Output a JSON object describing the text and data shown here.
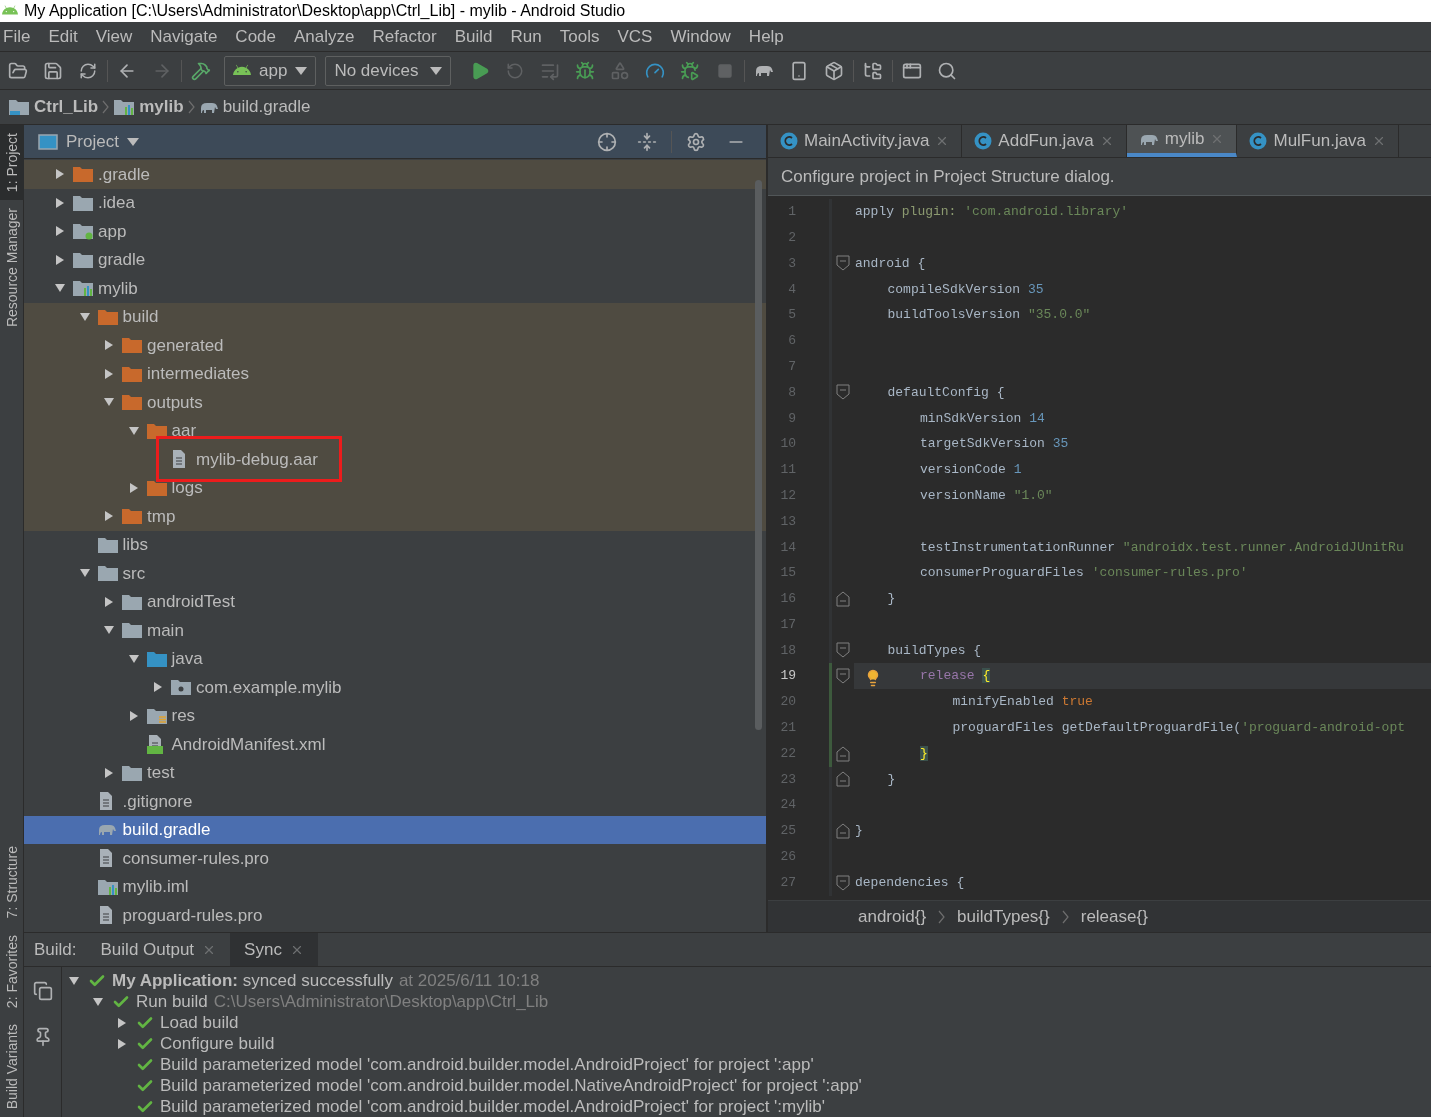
{
  "window": {
    "title": "My Application [C:\\Users\\Administrator\\Desktop\\app\\Ctrl_Lib] - mylib - Android Studio"
  },
  "menu": [
    "File",
    "Edit",
    "View",
    "Navigate",
    "Code",
    "Analyze",
    "Refactor",
    "Build",
    "Run",
    "Tools",
    "VCS",
    "Window",
    "Help"
  ],
  "toolbar": {
    "run_config": "app",
    "device": "No devices"
  },
  "breadcrumb": [
    {
      "label": "Ctrl_Lib",
      "kind": "project"
    },
    {
      "label": "mylib",
      "kind": "module"
    },
    {
      "label": "build.gradle",
      "kind": "gradle"
    }
  ],
  "tool_strip": {
    "top": [
      {
        "label": "1: Project",
        "selected": true
      },
      {
        "label": "Resource Manager",
        "selected": false
      }
    ],
    "bottom": [
      {
        "label": "7: Structure",
        "selected": false
      },
      {
        "label": "2: Favorites",
        "selected": false
      },
      {
        "label": "Build Variants",
        "selected": false
      }
    ]
  },
  "project": {
    "view": "Project",
    "tree": [
      {
        "label": ".gradle",
        "kind": "folder_excluded",
        "excluded": true,
        "selected": false,
        "expanded": false
      },
      {
        "label": ".idea",
        "kind": "folder",
        "excluded": false,
        "selected": false,
        "expanded": false
      },
      {
        "label": "app",
        "kind": "app_module",
        "excluded": false,
        "selected": false,
        "expanded": false
      },
      {
        "label": "gradle",
        "kind": "folder",
        "excluded": false,
        "selected": false,
        "expanded": false
      },
      {
        "label": "mylib",
        "kind": "module",
        "excluded": false,
        "selected": false,
        "expanded": true,
        "children": [
          {
            "label": "build",
            "kind": "folder_excluded",
            "excluded": true,
            "selected": false,
            "expanded": true,
            "children": [
              {
                "label": "generated",
                "kind": "folder_excluded",
                "excluded": true,
                "selected": false,
                "expanded": false
              },
              {
                "label": "intermediates",
                "kind": "folder_excluded",
                "excluded": true,
                "selected": false,
                "expanded": false
              },
              {
                "label": "outputs",
                "kind": "folder_excluded",
                "excluded": true,
                "selected": false,
                "expanded": true,
                "children": [
                  {
                    "label": "aar",
                    "kind": "folder_excluded",
                    "excluded": true,
                    "selected": false,
                    "expanded": true,
                    "children": [
                      {
                        "label": "mylib-debug.aar",
                        "kind": "file",
                        "excluded": true,
                        "selected": false,
                        "annotated": true
                      }
                    ]
                  },
                  {
                    "label": "logs",
                    "kind": "folder_excluded",
                    "excluded": true,
                    "selected": false,
                    "expanded": false
                  }
                ]
              },
              {
                "label": "tmp",
                "kind": "folder_excluded",
                "excluded": true,
                "selected": false,
                "expanded": false
              }
            ]
          },
          {
            "label": "libs",
            "kind": "folder",
            "excluded": false,
            "selected": false
          },
          {
            "label": "src",
            "kind": "folder",
            "excluded": false,
            "selected": false,
            "expanded": true,
            "children": [
              {
                "label": "androidTest",
                "kind": "folder",
                "excluded": false,
                "selected": false,
                "expanded": false
              },
              {
                "label": "main",
                "kind": "folder",
                "excluded": false,
                "selected": false,
                "expanded": true,
                "children": [
                  {
                    "label": "java",
                    "kind": "source_folder",
                    "excluded": false,
                    "selected": false,
                    "expanded": true,
                    "children": [
                      {
                        "label": "com.example.mylib",
                        "kind": "package",
                        "excluded": false,
                        "selected": false,
                        "expanded": false
                      }
                    ]
                  },
                  {
                    "label": "res",
                    "kind": "res_folder",
                    "excluded": false,
                    "selected": false,
                    "expanded": false
                  },
                  {
                    "label": "AndroidManifest.xml",
                    "kind": "manifest",
                    "excluded": false,
                    "selected": false
                  }
                ]
              },
              {
                "label": "test",
                "kind": "folder",
                "excluded": false,
                "selected": false,
                "expanded": false
              }
            ]
          },
          {
            "label": ".gitignore",
            "kind": "file",
            "excluded": false,
            "selected": false
          },
          {
            "label": "build.gradle",
            "kind": "gradle_file",
            "excluded": false,
            "selected": true
          },
          {
            "label": "consumer-rules.pro",
            "kind": "file",
            "excluded": false,
            "selected": false
          },
          {
            "label": "mylib.iml",
            "kind": "module",
            "excluded": false,
            "selected": false
          },
          {
            "label": "proguard-rules.pro",
            "kind": "file",
            "excluded": false,
            "selected": false
          }
        ]
      }
    ]
  },
  "editor": {
    "tabs": [
      {
        "label": "MainActivity.java",
        "kind": "java",
        "selected": false
      },
      {
        "label": "AddFun.java",
        "kind": "java",
        "selected": false
      },
      {
        "label": "mylib",
        "kind": "gradle",
        "selected": true
      },
      {
        "label": "MulFun.java",
        "kind": "java",
        "selected": false
      }
    ],
    "notice": "Configure project in Project Structure dialog.",
    "lines": [
      {
        "number": "1",
        "kind": "plain",
        "current": false,
        "changed": false,
        "tokens": [
          {
            "kind": "plain",
            "text": "apply "
          },
          {
            "kind": "arg",
            "text": "plugin: "
          },
          {
            "kind": "string",
            "text": "'com.android.library'"
          }
        ]
      },
      {
        "number": "2",
        "kind": "plain",
        "current": false,
        "changed": false
      },
      {
        "number": "3",
        "kind": "block_start",
        "current": false,
        "changed": false,
        "tokens": [
          {
            "kind": "plain",
            "text": "android {"
          }
        ]
      },
      {
        "number": "4",
        "kind": "plain",
        "current": false,
        "changed": false,
        "tokens": [
          {
            "kind": "plain",
            "text": "compileSdkVersion "
          },
          {
            "kind": "number",
            "text": "35"
          }
        ]
      },
      {
        "number": "5",
        "kind": "plain",
        "current": false,
        "changed": false,
        "tokens": [
          {
            "kind": "plain",
            "text": "buildToolsVersion "
          },
          {
            "kind": "string",
            "text": "\"35.0.0\""
          }
        ]
      },
      {
        "number": "6",
        "kind": "plain",
        "current": false,
        "changed": false
      },
      {
        "number": "7",
        "kind": "plain",
        "current": false,
        "changed": false
      },
      {
        "number": "8",
        "kind": "block_start",
        "current": false,
        "changed": false,
        "tokens": [
          {
            "kind": "plain",
            "text": "defaultConfig {"
          }
        ]
      },
      {
        "number": "9",
        "kind": "plain",
        "current": false,
        "changed": false,
        "tokens": [
          {
            "kind": "plain",
            "text": "minSdkVersion "
          },
          {
            "kind": "number",
            "text": "14"
          }
        ]
      },
      {
        "number": "10",
        "kind": "plain",
        "current": false,
        "changed": false,
        "tokens": [
          {
            "kind": "plain",
            "text": "targetSdkVersion "
          },
          {
            "kind": "number",
            "text": "35"
          }
        ]
      },
      {
        "number": "11",
        "kind": "plain",
        "current": false,
        "changed": false,
        "tokens": [
          {
            "kind": "plain",
            "text": "versionCode "
          },
          {
            "kind": "number",
            "text": "1"
          }
        ]
      },
      {
        "number": "12",
        "kind": "plain",
        "current": false,
        "changed": false,
        "tokens": [
          {
            "kind": "plain",
            "text": "versionName "
          },
          {
            "kind": "string",
            "text": "\"1.0\""
          }
        ]
      },
      {
        "number": "13",
        "kind": "plain",
        "current": false,
        "changed": false
      },
      {
        "number": "14",
        "kind": "plain",
        "current": false,
        "changed": false,
        "tokens": [
          {
            "kind": "plain",
            "text": "testInstrumentationRunner "
          },
          {
            "kind": "string",
            "text": "\"androidx.test.runner.AndroidJUnitRu"
          }
        ]
      },
      {
        "number": "15",
        "kind": "plain",
        "current": false,
        "changed": false,
        "tokens": [
          {
            "kind": "plain",
            "text": "consumerProguardFiles "
          },
          {
            "kind": "string",
            "text": "'consumer-rules.pro'"
          }
        ]
      },
      {
        "number": "16",
        "kind": "block_end",
        "current": false,
        "changed": false,
        "tokens": [
          {
            "kind": "plain",
            "text": "}"
          }
        ]
      },
      {
        "number": "17",
        "kind": "plain",
        "current": false,
        "changed": false
      },
      {
        "number": "18",
        "kind": "block_start",
        "current": false,
        "changed": false,
        "tokens": [
          {
            "kind": "plain",
            "text": "buildTypes {"
          }
        ]
      },
      {
        "number": "19",
        "kind": "block_start",
        "current": true,
        "changed": true,
        "intention": true,
        "tokens": [
          {
            "kind": "method",
            "text": "release "
          },
          {
            "kind": "match",
            "text": "{"
          }
        ]
      },
      {
        "number": "20",
        "kind": "plain",
        "current": false,
        "changed": true,
        "tokens": [
          {
            "kind": "plain",
            "text": "minifyEnabled "
          },
          {
            "kind": "keyword",
            "text": "true"
          }
        ]
      },
      {
        "number": "21",
        "kind": "plain",
        "current": false,
        "changed": true,
        "tokens": [
          {
            "kind": "plain",
            "text": "proguardFiles getDefaultProguardFile("
          },
          {
            "kind": "string",
            "text": "'proguard-android-opt"
          }
        ]
      },
      {
        "number": "22",
        "kind": "block_end",
        "current": false,
        "changed": true,
        "tokens": [
          {
            "kind": "match",
            "text": "}"
          }
        ]
      },
      {
        "number": "23",
        "kind": "block_end",
        "current": false,
        "changed": false,
        "tokens": [
          {
            "kind": "plain",
            "text": "}"
          }
        ]
      },
      {
        "number": "24",
        "kind": "plain",
        "current": false,
        "changed": false
      },
      {
        "number": "25",
        "kind": "block_end",
        "current": false,
        "changed": false,
        "tokens": [
          {
            "kind": "plain",
            "text": "}"
          }
        ]
      },
      {
        "number": "26",
        "kind": "plain",
        "current": false,
        "changed": false
      },
      {
        "number": "27",
        "kind": "block_start",
        "current": false,
        "changed": false,
        "tokens": [
          {
            "kind": "plain",
            "text": "dependencies {"
          }
        ]
      }
    ],
    "path": [
      "android{}",
      "buildTypes{}",
      "release{}"
    ]
  },
  "build": {
    "label": "Build:",
    "tabs": [
      {
        "label": "Build Output",
        "selected": false
      },
      {
        "label": "Sync",
        "selected": true
      }
    ],
    "tree": [
      {
        "text": "**My Application:** synced successfully",
        "detail": "at 2025/6/11 10:18",
        "kind": "success",
        "expanded": true,
        "children": [
          {
            "text": "Run build",
            "detail": "C:\\Users\\Administrator\\Desktop\\app\\Ctrl_Lib",
            "kind": "success",
            "expanded": true,
            "children": [
              {
                "text": "Load build",
                "kind": "success",
                "expanded": false
              },
              {
                "text": "Configure build",
                "kind": "success",
                "expanded": false
              },
              {
                "text": "Build parameterized model 'com.android.builder.model.AndroidProject' for project ':app'",
                "kind": "success"
              },
              {
                "text": "Build parameterized model 'com.android.builder.model.NativeAndroidProject' for project ':app'",
                "kind": "success"
              },
              {
                "text": "Build parameterized model 'com.android.builder.model.AndroidProject' for project ':mylib'",
                "kind": "success"
              }
            ]
          }
        ]
      }
    ]
  }
}
